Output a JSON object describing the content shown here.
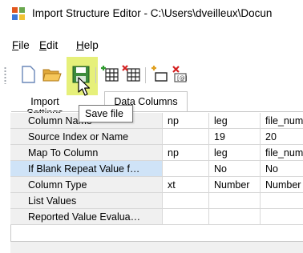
{
  "window": {
    "title": "Import Structure Editor - C:\\Users\\dveilleux\\Docun"
  },
  "menu": {
    "items": [
      {
        "label": "File",
        "accel": "F",
        "rest": "ile"
      },
      {
        "label": "Edit",
        "accel": "E",
        "rest": "dit"
      },
      {
        "label": "Help",
        "accel": "H",
        "rest": "elp"
      }
    ]
  },
  "toolbar": {
    "buttons": [
      {
        "name": "new-file-icon"
      },
      {
        "name": "open-folder-icon"
      },
      {
        "name": "save-file-icon"
      },
      {
        "name": "add-column-icon"
      },
      {
        "name": "delete-column-icon"
      },
      {
        "name": "insert-row-icon"
      },
      {
        "name": "delete-row-icon"
      }
    ],
    "highlight_color": "#e6f07a"
  },
  "tooltip": {
    "text": "Save file"
  },
  "tabs": {
    "inactive_label": "Import Settings",
    "active_label": "Data Columns"
  },
  "grid": {
    "rows": [
      {
        "label": "Column Name",
        "cells": [
          "np",
          "leg",
          "file_num"
        ]
      },
      {
        "label": "Source Index or Name",
        "cells": [
          "",
          "19",
          "20"
        ]
      },
      {
        "label": "Map To Column",
        "cells": [
          "np",
          "leg",
          "file_num"
        ]
      },
      {
        "label": "If Blank Repeat Value f…",
        "cells": [
          "",
          "No",
          "No"
        ]
      },
      {
        "label": "Column Type",
        "cells": [
          "xt",
          "Number",
          "Number"
        ]
      },
      {
        "label": "List Values",
        "cells": [
          "",
          "",
          ""
        ]
      },
      {
        "label": "Reported Value Evalua…",
        "cells": [
          "",
          "",
          ""
        ]
      }
    ],
    "selected_row": 3,
    "selected_color": "#cfe3f7"
  }
}
